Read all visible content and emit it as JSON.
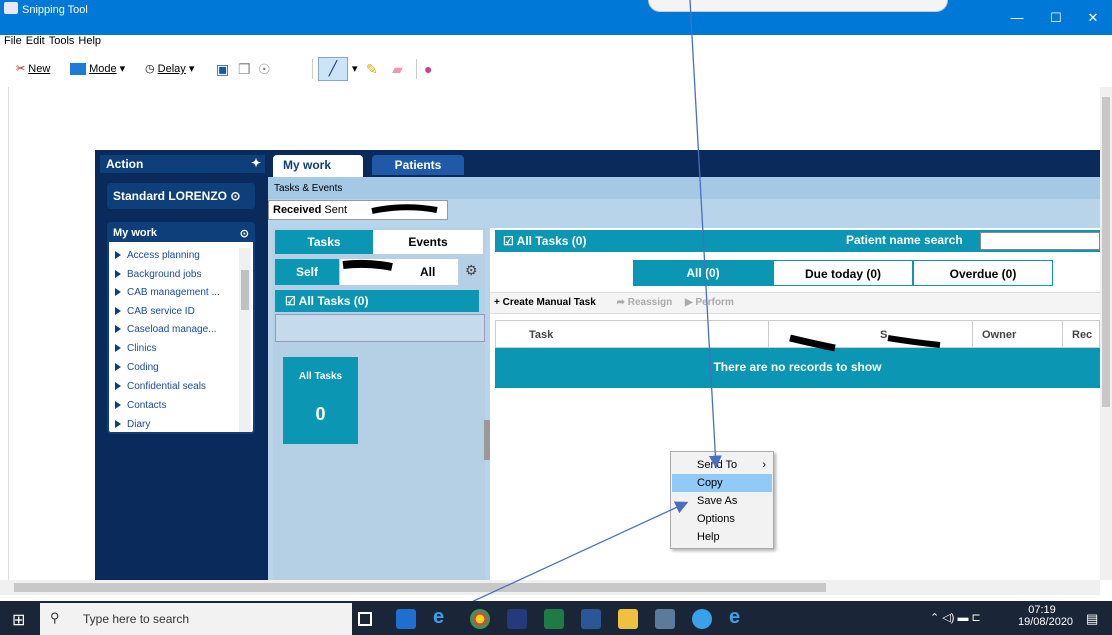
{
  "window": {
    "title": "Snipping Tool",
    "minimize": "—",
    "maximize": "☐",
    "close": "✕"
  },
  "menu": [
    "File",
    "Edit",
    "Tools",
    "Help"
  ],
  "toolbar": {
    "new": "New",
    "mode": "Mode",
    "delay": "Delay"
  },
  "app": {
    "action_title": "Action",
    "tabs": [
      "My work",
      "Patients"
    ],
    "profile": "Standard LORENZO",
    "mywork_title": "My work",
    "mywork_items": [
      "Access planning",
      "Background jobs",
      "CAB management ...",
      "CAB service ID",
      "Caseload manage...",
      "Clinics",
      "Coding",
      "Confidential seals",
      "Contacts",
      "Diary"
    ],
    "breadcrumb": "Tasks & Events",
    "received_sent": [
      "Received",
      "Sent"
    ],
    "tasks_events": [
      "Tasks",
      "Events"
    ],
    "self_all": [
      "Self",
      "All"
    ],
    "all_tasks_label": "All Tasks (0)",
    "tile": {
      "label": "All Tasks",
      "count": "0"
    },
    "right_header": "All Tasks (0)",
    "patient_search_label": "Patient name search",
    "filters": [
      "All (0)",
      "Due today (0)",
      "Overdue (0)"
    ],
    "actions": [
      "Create Manual Task",
      "Reassign",
      "Perform"
    ],
    "columns": [
      "Task",
      "",
      "S",
      "Owner",
      "Rec"
    ],
    "empty_message": "There are no records to show"
  },
  "context_menu": [
    "Send To",
    "Copy",
    "Save As",
    "Options",
    "Help"
  ],
  "taskbar": {
    "search_placeholder": "Type here to search",
    "time": "07:19",
    "date": "19/08/2020"
  },
  "colors": {
    "titlebar": "#0078d7",
    "teal": "#0b96b4",
    "navy": "#0a2a5c",
    "light_blue": "#b8d4ea",
    "taskbar": "#1a2638"
  }
}
